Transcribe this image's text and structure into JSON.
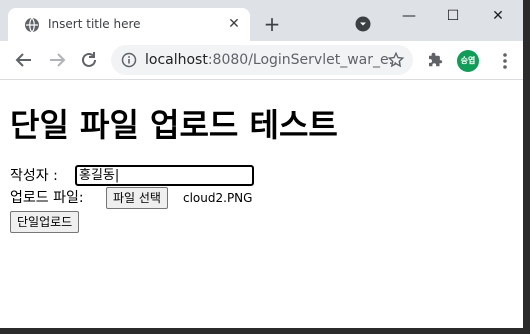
{
  "browser": {
    "tab_title": "Insert title here",
    "close_glyph": "✕",
    "newtab_glyph": "+",
    "url_host": "localhost",
    "url_path": ":8080/LoginServlet_war_e...",
    "avatar_text": "승엽",
    "window_controls": {
      "minimize": "—",
      "maximize": "☐",
      "close": "✕"
    },
    "icons": [
      "globe-icon",
      "tab-search-icon",
      "back-arrow-icon",
      "forward-arrow-icon",
      "reload-icon",
      "info-icon",
      "star-icon",
      "extensions-icon",
      "kebab-menu-icon"
    ]
  },
  "page": {
    "heading": "단일 파일 업로드 테스트",
    "author_label": "작성자 : ",
    "author_value": "홍길동|",
    "upload_label": "업로드 파일: ",
    "choose_file_button": "파일 선택",
    "selected_file": "cloud2.PNG",
    "submit_button": "단일업로드"
  },
  "colors": {
    "tabstrip": "#dee1e6",
    "avatar": "#0f9d58",
    "omnibox": "#f1f3f4"
  }
}
